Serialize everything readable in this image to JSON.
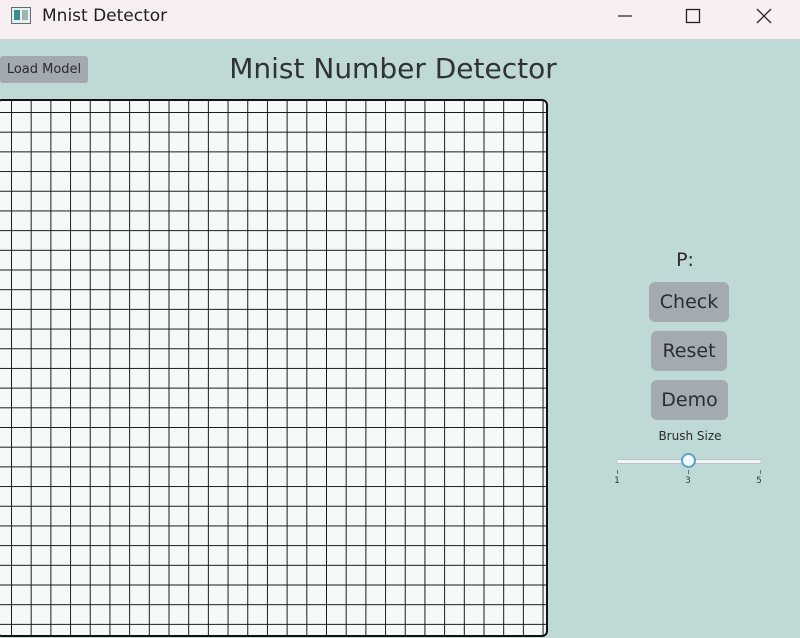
{
  "window": {
    "title": "Mnist Detector"
  },
  "toolbar": {
    "load_model_label": "Load Model"
  },
  "header": {
    "title": "Mnist Number Detector"
  },
  "panel": {
    "prediction_label": "P:",
    "check_label": "Check",
    "reset_label": "Reset",
    "demo_label": "Demo",
    "brush": {
      "label": "Brush Size",
      "value": 3,
      "min": 1,
      "max": 5,
      "ticks": [
        "1",
        "3",
        "5"
      ]
    }
  },
  "colors": {
    "background": "#bfd9d6",
    "button": "#a4aab2",
    "titlebar": "#f8eff2",
    "slider_accent": "#5aa2c9"
  }
}
